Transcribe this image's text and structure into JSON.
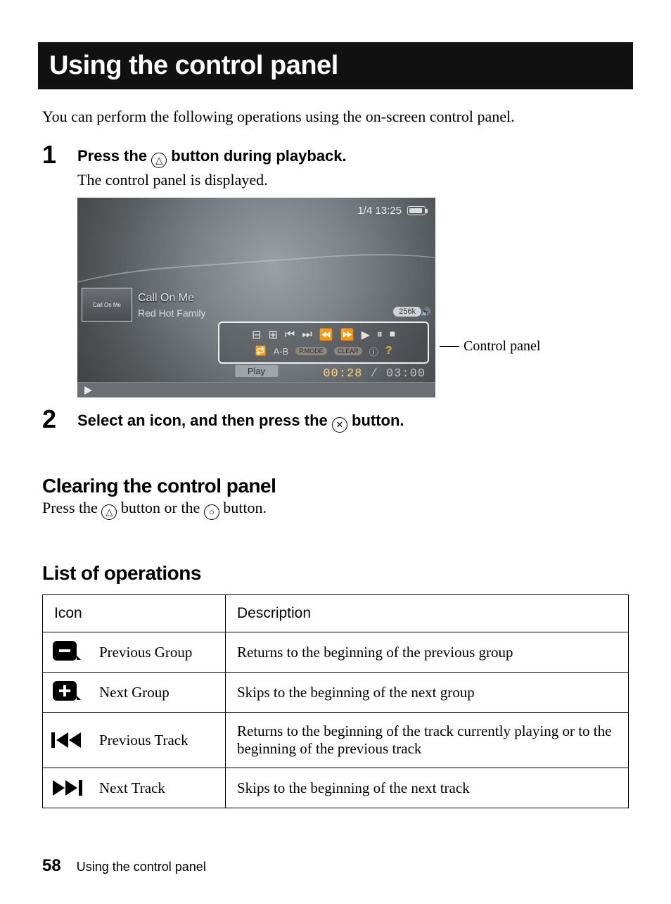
{
  "title": "Using the control panel",
  "intro": "You can perform the following operations using the on-screen control panel.",
  "step1": {
    "num": "1",
    "head_before": "Press the ",
    "head_after": " button during playback.",
    "sub": "The control panel is displayed."
  },
  "shot": {
    "status": "1/4 13:25",
    "album_text": "Call On Me",
    "track_title": "Call On Me",
    "track_artist": "Red Hot Family",
    "bitrate": "256k",
    "ab": "A-B",
    "pmode": "P.MODE",
    "clear": "CLEAR",
    "play_label": "Play",
    "time_cur": "00:28",
    "time_sep": " / ",
    "time_total": "03:00",
    "callout": "Control panel"
  },
  "step2": {
    "num": "2",
    "head_before": "Select an icon, and then press the ",
    "head_after": " button."
  },
  "clearing": {
    "heading": "Clearing the control panel",
    "body_a": "Press the ",
    "body_mid": " button or the ",
    "body_end": " button."
  },
  "list_heading": "List of operations",
  "table": {
    "header_icon": "Icon",
    "header_desc": "Description",
    "rows": [
      {
        "label": "Previous Group",
        "desc": "Returns to the beginning of the previous group"
      },
      {
        "label": "Next Group",
        "desc": "Skips to the beginning of the next group"
      },
      {
        "label": "Previous Track",
        "desc": "Returns to the beginning of the track currently playing or to the beginning of the previous track"
      },
      {
        "label": "Next Track",
        "desc": "Skips to the beginning of the next track"
      }
    ]
  },
  "footer": {
    "page": "58",
    "title": "Using the control panel"
  }
}
